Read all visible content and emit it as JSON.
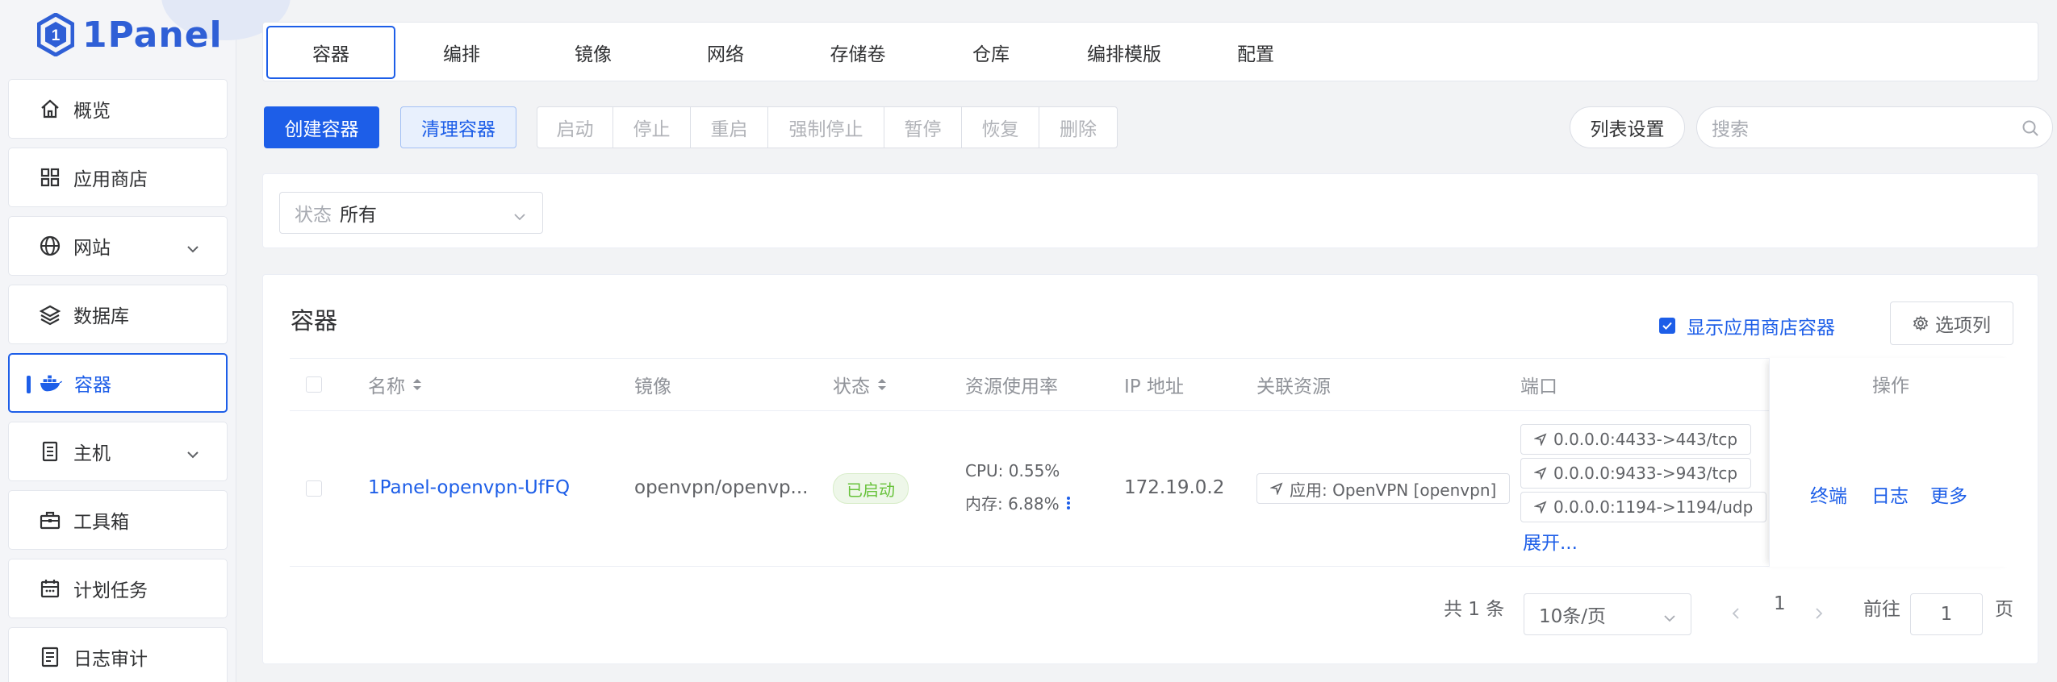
{
  "app": {
    "logo_text": "1Panel"
  },
  "sidebar": {
    "items": [
      {
        "label": "概览",
        "icon": "home-icon"
      },
      {
        "label": "应用商店",
        "icon": "grid-icon"
      },
      {
        "label": "网站",
        "icon": "globe-icon",
        "has_children": true
      },
      {
        "label": "数据库",
        "icon": "layers-icon"
      },
      {
        "label": "容器",
        "icon": "docker-icon",
        "active": true
      },
      {
        "label": "主机",
        "icon": "server-icon",
        "has_children": true
      },
      {
        "label": "工具箱",
        "icon": "toolbox-icon"
      },
      {
        "label": "计划任务",
        "icon": "calendar-icon"
      },
      {
        "label": "日志审计",
        "icon": "log-icon"
      }
    ]
  },
  "tabs": [
    "容器",
    "编排",
    "镜像",
    "网络",
    "存储卷",
    "仓库",
    "编排模版",
    "配置"
  ],
  "toolbar": {
    "create": "创建容器",
    "prune": "清理容器",
    "actions": [
      "启动",
      "停止",
      "重启",
      "强制停止",
      "暂停",
      "恢复",
      "删除"
    ],
    "list_settings": "列表设置",
    "search_placeholder": "搜索"
  },
  "filter": {
    "label": "状态",
    "value": "所有"
  },
  "panel": {
    "title": "容器",
    "show_store_label": "显示应用商店容器",
    "show_store_checked": true,
    "columns_button": "选项列"
  },
  "table": {
    "headers": {
      "name": "名称",
      "image": "镜像",
      "status": "状态",
      "resources": "资源使用率",
      "ip": "IP 地址",
      "related": "关联资源",
      "ports": "端口",
      "ops": "操作"
    },
    "rows": [
      {
        "name": "1Panel-openvpn-UfFQ",
        "image": "openvpn/openvp...",
        "status": "已启动",
        "cpu": "CPU: 0.55%",
        "mem": "内存: 6.88%",
        "ip": "172.19.0.2",
        "related": "应用: OpenVPN [openvpn]",
        "ports": [
          "0.0.0.0:4433->443/tcp",
          "0.0.0.0:9433->943/tcp",
          "0.0.0.0:1194->1194/udp"
        ],
        "expand": "展开...",
        "ops": [
          "终端",
          "日志",
          "更多"
        ]
      }
    ]
  },
  "pagination": {
    "total": "共 1 条",
    "page_size": "10条/页",
    "current": "1",
    "goto_label": "前往",
    "goto_value": "1",
    "page_suffix": "页"
  },
  "colors": {
    "primary": "#1d5ee8",
    "success": "#67c23a"
  }
}
